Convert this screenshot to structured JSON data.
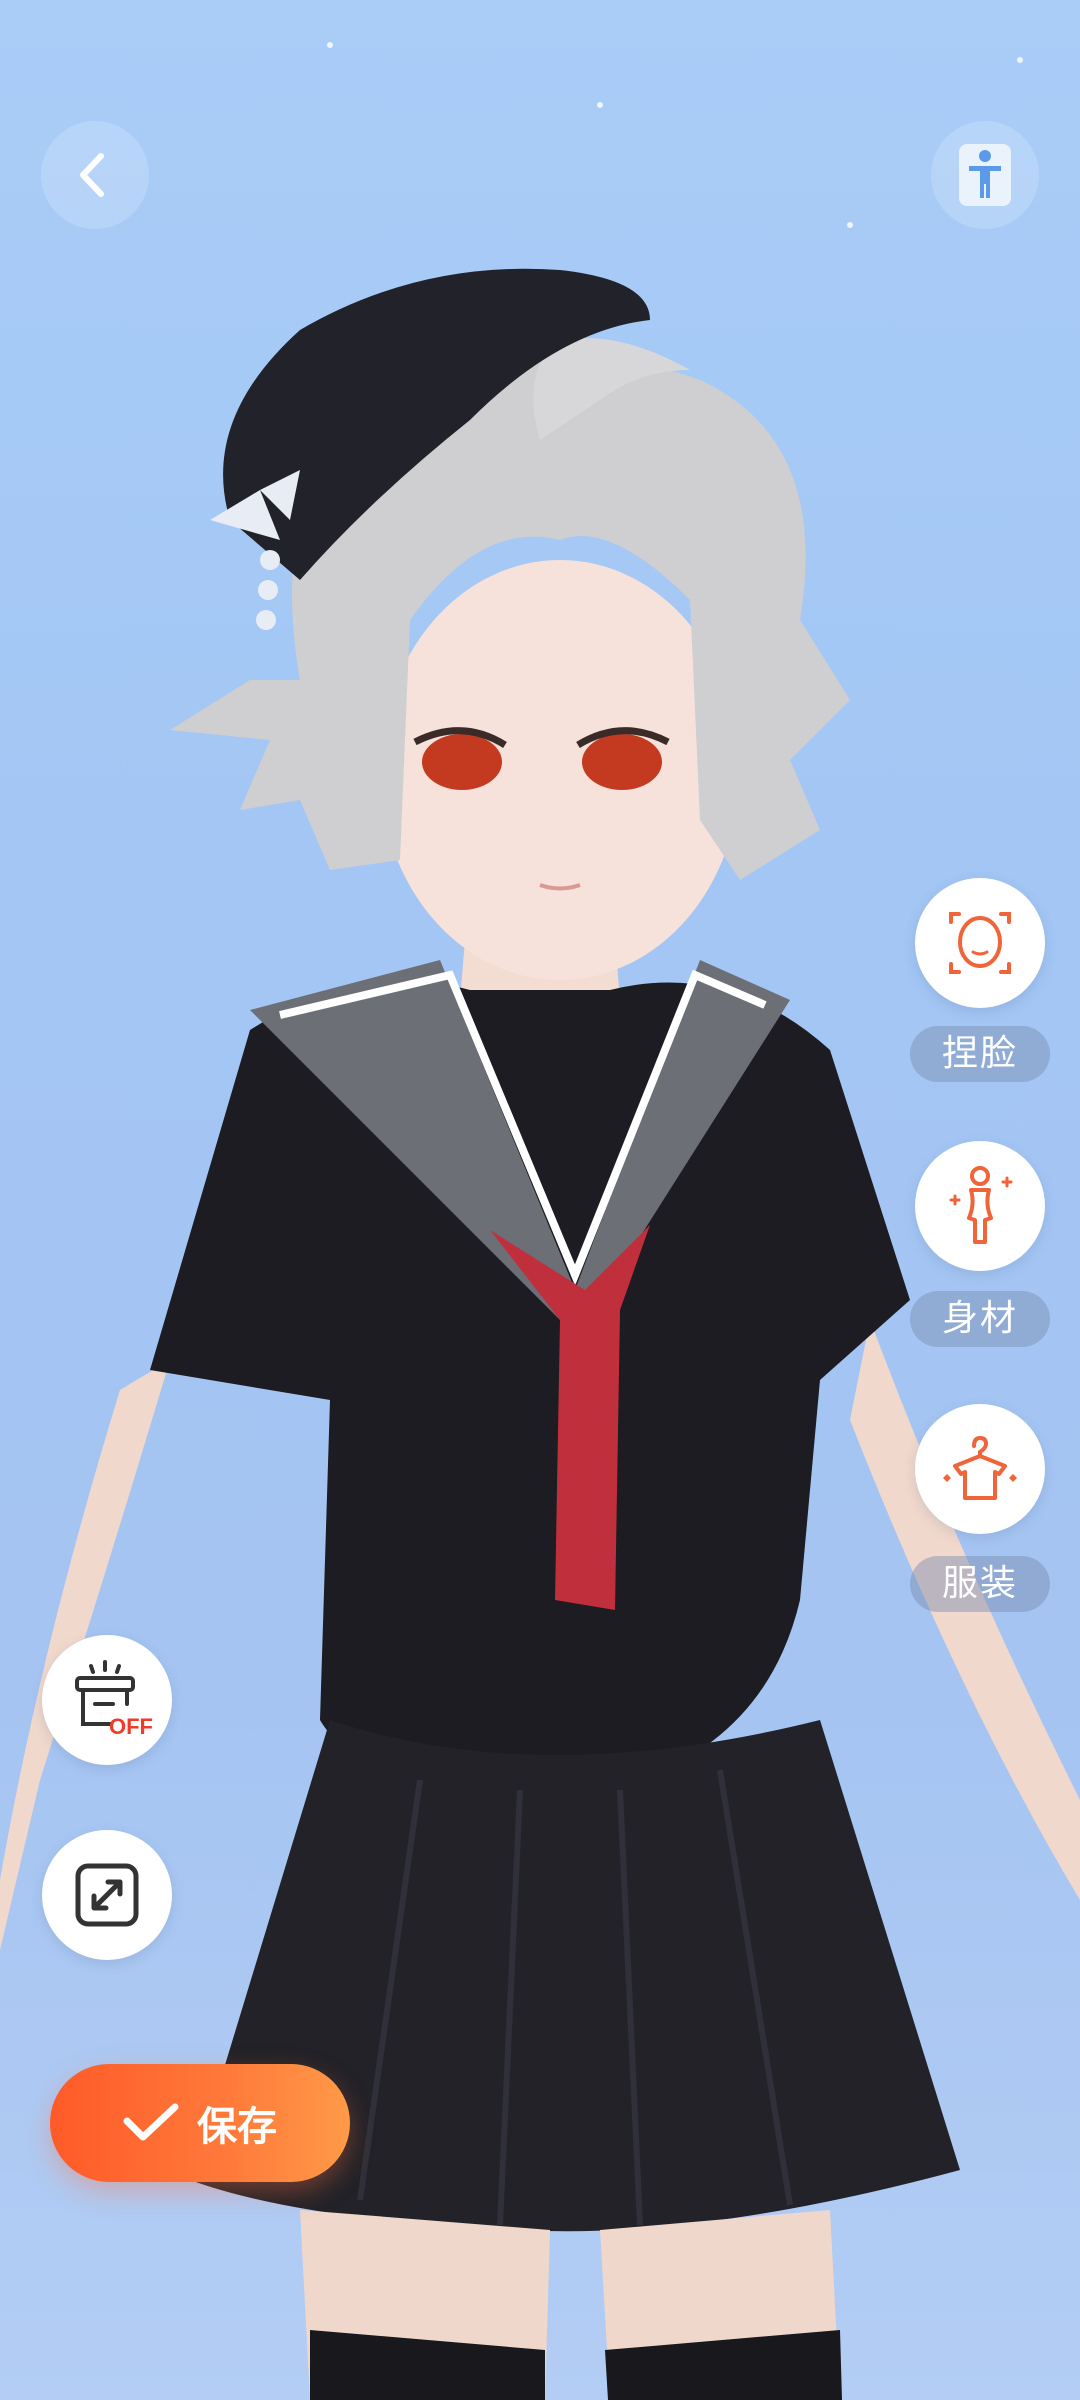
{
  "nav": {
    "back_icon": "chevron-left-icon",
    "pose_icon": "body-pose-icon"
  },
  "side_menu": [
    {
      "label": "捏脸",
      "icon": "face-shape-icon"
    },
    {
      "label": "身材",
      "icon": "body-figure-icon"
    },
    {
      "label": "服装",
      "icon": "clothing-hanger-icon"
    }
  ],
  "tools": {
    "light_toggle_badge": "OFF",
    "light_toggle_icon": "lamp-off-icon",
    "fullscreen_icon": "expand-icon"
  },
  "save": {
    "label": "保存",
    "icon": "check-icon"
  },
  "colors": {
    "accent": "#ff6a30",
    "background": "#a7c8f5",
    "icon_orange": "#f0643a"
  }
}
